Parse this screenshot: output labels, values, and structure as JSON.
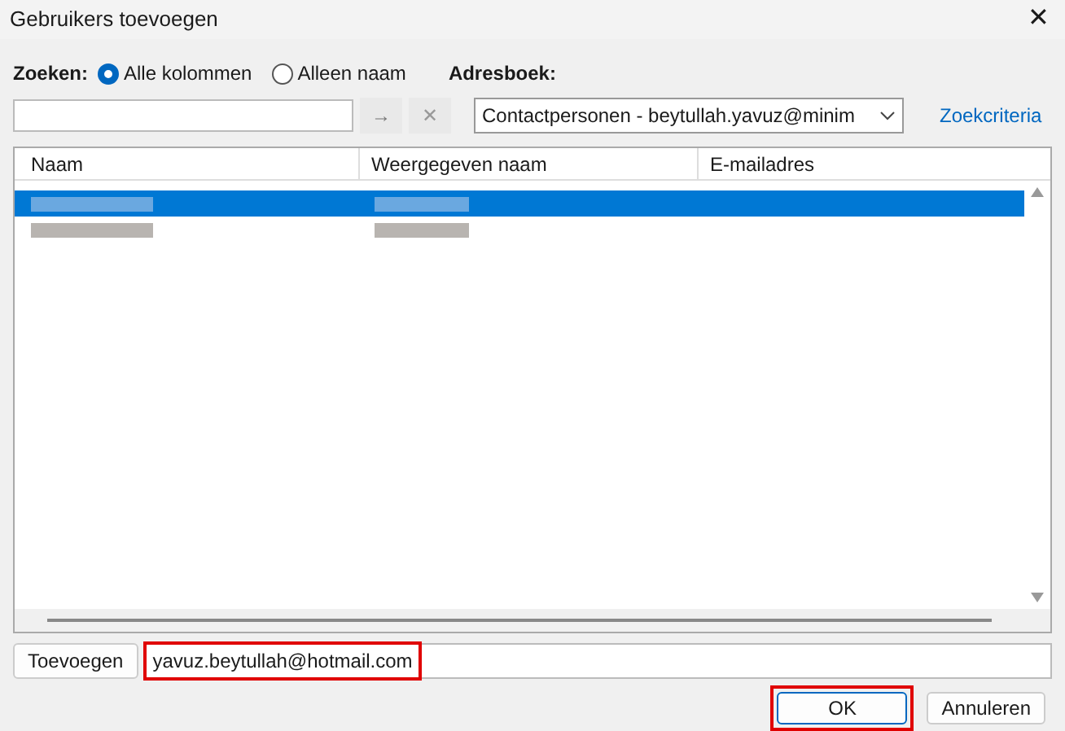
{
  "window": {
    "title": "Gebruikers toevoegen",
    "close": "✕"
  },
  "search": {
    "label": "Zoeken:",
    "scope": [
      {
        "label": "Alle kolommen",
        "selected": true
      },
      {
        "label": "Alleen naam",
        "selected": false
      }
    ],
    "go": "→",
    "clear": "✕"
  },
  "address_book": {
    "label": "Adresboek:",
    "value": "Contactpersonen - beytullah.yavuz@minim",
    "link": "Zoekcriteria"
  },
  "table": {
    "columns": [
      "Naam",
      "Weergegeven naam",
      "E-mailadres"
    ],
    "rows": [
      {
        "selected": true
      },
      {
        "selected": false
      }
    ]
  },
  "add": {
    "button": "Toevoegen",
    "value": "yavuz.beytullah@hotmail.com",
    "highlighted": true
  },
  "buttons": [
    {
      "label": "OK",
      "highlighted": true
    },
    {
      "label": "Annuleren",
      "highlighted": false
    }
  ]
}
